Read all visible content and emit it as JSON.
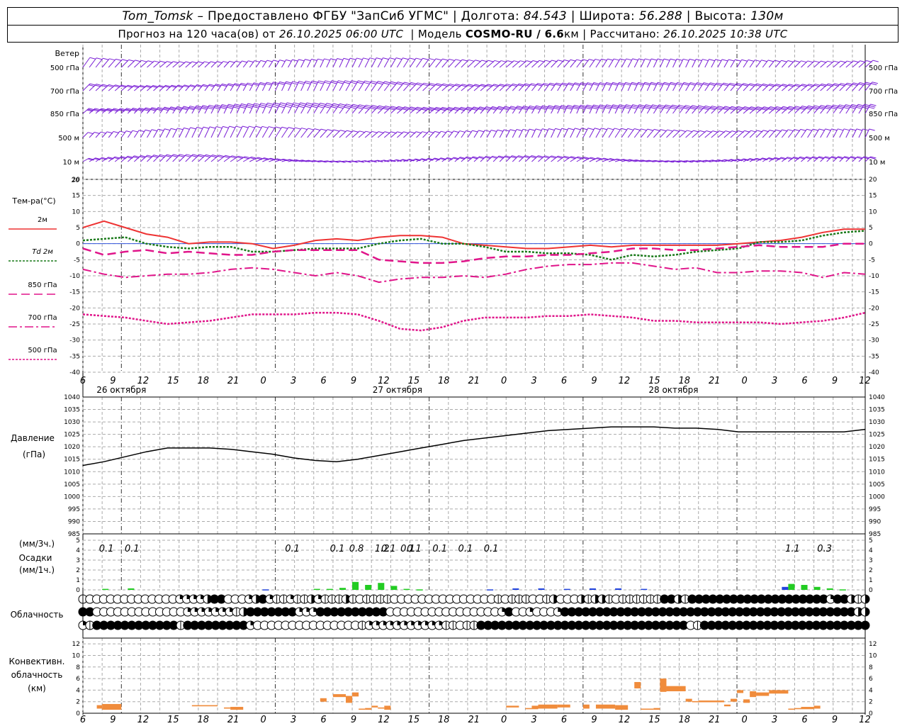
{
  "header": {
    "station": "Tom_Tomsk",
    "provider": "– Предоставлено ФГБУ \"ЗапСиб УГМС\"",
    "lon_label": "Долгота:",
    "lon_value": "84.543",
    "lat_label": "Широта:",
    "lat_value": "56.288",
    "alt_label": "Высота:",
    "alt_value": "130м",
    "forecast_label": "Прогноз на 120 часа(ов) от",
    "forecast_start": "26.10.2025 06:00 UTC",
    "model_label": "Модель",
    "model_name": "COSMO-RU / 6.6",
    "model_unit": "км",
    "calc_label": "Рассчитано:",
    "calc_time": "26.10.2025 10:38 UTC"
  },
  "colors": {
    "wind": "#7a1fd6",
    "t2m": "#ee3333",
    "td2m": "#1a7a1a",
    "t850": "#e0158a",
    "t700": "#e0158a",
    "t500": "#e0158a",
    "pressure": "#000000",
    "precip_rain": "#22cc22",
    "precip_snow": "#2244dd",
    "convective": "#f08c3c",
    "grid": "#aaaaaa",
    "zero_line": "#3355dd"
  },
  "chart_data": {
    "time_axis": {
      "hour_labels": [
        "6",
        "9",
        "12",
        "15",
        "18",
        "21",
        "0",
        "3",
        "6",
        "9",
        "12",
        "15",
        "18",
        "21",
        "0",
        "3",
        "6",
        "9",
        "12",
        "15",
        "18",
        "21",
        "0",
        "3",
        "6",
        "9",
        "12"
      ],
      "date_labels": [
        "26 октября",
        "27 октября",
        "28 октября"
      ]
    },
    "wind_panel": {
      "title": "Ветер",
      "levels": [
        "500 гПа",
        "700 гПа",
        "850 гПа",
        "500 м",
        "10 м"
      ]
    },
    "temperature": {
      "type": "line",
      "ylabel": "Тем-ра(°С)",
      "ylim": [
        -40,
        20
      ],
      "ticks": [
        "20",
        "15",
        "10",
        "5",
        "0",
        "-5",
        "-10",
        "-15",
        "-20",
        "-25",
        "-30",
        "-35",
        "-40"
      ],
      "legend": [
        "2м",
        "Td 2м",
        "850 гПа",
        "700 гПа",
        "500 гПа"
      ],
      "t2m": [
        5,
        7,
        5,
        3,
        2,
        0,
        0.5,
        0.5,
        0,
        -1.5,
        -0.5,
        1,
        1.5,
        1,
        2,
        2.5,
        2.5,
        2,
        0,
        -0.5,
        -1,
        -1.5,
        -1.5,
        -1,
        -0.5,
        -1,
        -0.5,
        -0.5,
        -0.5,
        -0.5,
        -0.5,
        0,
        0.5,
        1,
        2,
        3.5,
        4.5,
        4.5
      ],
      "td2m": [
        1,
        1.5,
        2,
        0,
        -1,
        -1.5,
        -1,
        -1,
        -2.5,
        -2.5,
        -2,
        -1.5,
        -1.5,
        -1.5,
        0,
        1,
        1.5,
        0,
        0,
        -1,
        -2.5,
        -2.5,
        -3,
        -3,
        -3.5,
        -5,
        -3.5,
        -4,
        -3.5,
        -2.5,
        -2,
        -1.5,
        0.5,
        0.5,
        1,
        2.5,
        3.5,
        4
      ],
      "t850": [
        -1.5,
        -3.5,
        -2.5,
        -2,
        -3,
        -2.5,
        -3,
        -3.5,
        -3.5,
        -2.5,
        -2,
        -2,
        -2,
        -2,
        -5,
        -5.5,
        -6,
        -6,
        -5.5,
        -4.5,
        -4,
        -4,
        -3.5,
        -3.5,
        -3,
        -2.5,
        -1.5,
        -1.5,
        -2,
        -2,
        -1.5,
        -1,
        -0.5,
        -1,
        -1,
        -1,
        0,
        0
      ],
      "t700": [
        -8,
        -9.5,
        -10.5,
        -10,
        -9.5,
        -9.5,
        -9,
        -8,
        -7.5,
        -8,
        -9,
        -10,
        -9,
        -10,
        -12,
        -11,
        -10.5,
        -10.5,
        -10,
        -10.5,
        -9.5,
        -8,
        -7,
        -6.5,
        -6.5,
        -6,
        -6,
        -7,
        -8,
        -7.5,
        -9,
        -9,
        -8.5,
        -8.5,
        -9,
        -10.5,
        -9,
        -9.5
      ],
      "t500": [
        -22,
        -22.5,
        -23,
        -24,
        -25,
        -24.5,
        -24,
        -23,
        -22,
        -22,
        -22,
        -21.5,
        -21.5,
        -22,
        -24,
        -26.5,
        -27,
        -26,
        -24,
        -23,
        -23,
        -23,
        -22.5,
        -22.5,
        -22,
        -22.5,
        -23,
        -24,
        -24,
        -24.5,
        -24.5,
        -24.5,
        -24.5,
        -25,
        -24.5,
        -24,
        -23,
        -21.5
      ]
    },
    "pressure": {
      "type": "line",
      "ylabel": "Давление",
      "unit_label": "(гПа)",
      "ylim": [
        985,
        1040
      ],
      "ticks": [
        "1040",
        "1035",
        "1030",
        "1025",
        "1020",
        "1015",
        "1010",
        "1005",
        "1000",
        "995",
        "990",
        "985"
      ],
      "values": [
        1012.5,
        1014,
        1016,
        1018,
        1019.5,
        1019.5,
        1019.5,
        1019,
        1018,
        1017,
        1015.5,
        1014.5,
        1014,
        1015,
        1016.5,
        1018,
        1019.5,
        1021,
        1022.5,
        1023.5,
        1024.5,
        1025.5,
        1026.5,
        1027,
        1027.5,
        1028,
        1028,
        1028,
        1027.5,
        1027.5,
        1027,
        1026,
        1026,
        1026,
        1026,
        1026,
        1026,
        1027
      ]
    },
    "precipitation": {
      "type": "bar",
      "label_3h": "(мм/3ч.)",
      "ylabel": "Осадки",
      "label_1h": "(мм/1ч.)",
      "ylim": [
        0,
        5
      ],
      "ticks": [
        "5",
        "4",
        "3",
        "2",
        "1",
        "0"
      ],
      "amount_labels": [
        {
          "t": 9,
          "text": "0.1"
        },
        {
          "t": 21,
          "text": "0.1"
        },
        {
          "t": 96,
          "text": "0.1"
        },
        {
          "t": 117,
          "text": "0.1"
        },
        {
          "t": 141,
          "text": "0.1"
        },
        {
          "t": 153,
          "text": "0.1"
        },
        {
          "t": 165,
          "text": "0.1"
        },
        {
          "t": 177,
          "text": "0.1"
        },
        {
          "t": 189,
          "text": "0.1"
        },
        {
          "t": 330,
          "text": "1.1"
        },
        {
          "t": 345,
          "text": "0.3"
        }
      ],
      "amount_labels_b": [
        {
          "t": 126,
          "text": "0.8"
        },
        {
          "t": 138,
          "text": "1.2"
        },
        {
          "t": 150,
          "text": "0.1"
        }
      ],
      "bars": [
        {
          "t": 9,
          "v": 0.1,
          "kind": "rain"
        },
        {
          "t": 21,
          "v": 0.15,
          "kind": "rain"
        },
        {
          "t": 84,
          "v": 0.05,
          "kind": "snow"
        },
        {
          "t": 108,
          "v": 0.1,
          "kind": "rain"
        },
        {
          "t": 114,
          "v": 0.1,
          "kind": "rain"
        },
        {
          "t": 120,
          "v": 0.2,
          "kind": "rain"
        },
        {
          "t": 126,
          "v": 0.8,
          "kind": "rain"
        },
        {
          "t": 132,
          "v": 0.5,
          "kind": "rain"
        },
        {
          "t": 138,
          "v": 0.7,
          "kind": "rain"
        },
        {
          "t": 144,
          "v": 0.4,
          "kind": "rain"
        },
        {
          "t": 150,
          "v": 0.1,
          "kind": "rain"
        },
        {
          "t": 156,
          "v": 0.05,
          "kind": "rain"
        },
        {
          "t": 189,
          "v": 0.05,
          "kind": "snow"
        },
        {
          "t": 201,
          "v": 0.15,
          "kind": "snow"
        },
        {
          "t": 213,
          "v": 0.15,
          "kind": "snow"
        },
        {
          "t": 225,
          "v": 0.1,
          "kind": "snow"
        },
        {
          "t": 237,
          "v": 0.15,
          "kind": "snow"
        },
        {
          "t": 249,
          "v": 0.15,
          "kind": "snow"
        },
        {
          "t": 261,
          "v": 0.1,
          "kind": "snow"
        },
        {
          "t": 327,
          "v": 0.3,
          "kind": "snow"
        },
        {
          "t": 330,
          "v": 0.6,
          "kind": "rain"
        },
        {
          "t": 336,
          "v": 0.5,
          "kind": "rain"
        },
        {
          "t": 342,
          "v": 0.3,
          "kind": "rain"
        },
        {
          "t": 348,
          "v": 0.15,
          "kind": "rain"
        },
        {
          "t": 354,
          "v": 0.05,
          "kind": "rain"
        }
      ]
    },
    "cloudiness": {
      "label": "Облачность",
      "rows": [
        [
          1,
          0,
          0,
          0,
          0,
          0,
          0,
          0,
          0,
          0,
          0,
          0,
          0,
          0,
          2,
          2,
          2,
          2,
          3,
          4,
          4,
          0,
          0,
          0,
          2,
          3,
          4,
          2,
          1,
          1,
          2,
          1,
          1,
          3,
          2,
          1,
          1,
          1,
          3,
          1,
          0,
          1,
          1,
          1,
          1,
          0,
          0,
          0,
          0,
          0,
          0,
          0,
          0,
          0,
          0,
          0,
          0,
          0,
          0,
          0,
          1,
          0,
          1,
          1,
          1,
          0,
          0,
          1,
          3,
          0,
          0,
          0,
          3,
          1,
          3,
          3,
          1,
          0,
          1,
          1,
          1,
          1,
          1,
          1,
          4,
          4,
          3,
          1,
          4,
          4,
          4,
          4,
          4,
          4,
          4,
          4,
          4,
          4,
          4,
          4,
          4,
          4,
          4,
          4,
          4,
          4,
          4,
          4,
          2,
          4,
          4,
          3,
          1,
          3
        ],
        [
          4,
          4,
          0,
          0,
          0,
          0,
          0,
          0,
          0,
          0,
          0,
          0,
          0,
          0,
          0,
          2,
          2,
          2,
          2,
          2,
          2,
          2,
          1,
          3,
          4,
          4,
          4,
          4,
          4,
          4,
          4,
          2,
          2,
          2,
          4,
          4,
          4,
          4,
          4,
          4,
          4,
          4,
          4,
          4,
          0,
          0,
          0,
          0,
          0,
          0,
          0,
          0,
          0,
          0,
          0,
          0,
          0,
          0,
          0,
          0,
          2,
          4,
          0,
          0,
          2,
          0,
          0,
          0,
          2,
          4,
          4,
          4,
          4,
          4,
          4,
          4,
          4,
          4,
          4,
          4,
          4,
          4,
          4,
          4,
          4,
          4,
          4,
          4,
          4,
          4,
          4,
          4,
          4,
          4,
          4,
          4,
          4,
          4,
          4,
          4,
          4,
          4,
          4,
          4,
          4,
          4,
          4,
          4,
          4,
          4,
          4,
          3,
          3
        ],
        [
          2,
          1,
          4,
          4,
          4,
          4,
          4,
          4,
          4,
          4,
          4,
          4,
          4,
          4,
          1,
          4,
          4,
          4,
          4,
          4,
          4,
          4,
          4,
          4,
          2,
          0,
          0,
          0,
          0,
          0,
          0,
          0,
          0,
          0,
          0,
          0,
          0,
          0,
          0,
          0,
          1,
          2,
          2,
          2,
          2,
          2,
          2,
          2,
          2,
          2,
          2,
          2,
          1,
          1,
          0,
          1,
          1,
          4,
          4,
          4,
          4,
          4,
          4,
          4,
          4,
          4,
          4,
          4,
          4,
          4,
          4,
          4,
          4,
          4,
          4,
          4,
          4,
          4,
          4,
          4,
          4,
          4,
          4,
          4,
          4,
          4,
          4,
          0,
          1,
          4,
          4,
          4,
          4,
          4,
          4,
          4,
          4,
          4,
          4,
          4,
          4,
          4,
          4,
          4,
          4,
          4,
          4,
          4,
          4,
          4,
          4,
          4,
          4
        ]
      ]
    },
    "convective": {
      "type": "bar",
      "label_lines": [
        "Конвективн.",
        "облачность",
        "(км)"
      ],
      "ylim": [
        0,
        13
      ],
      "ticks": [
        "12",
        "10",
        "8",
        "6",
        "4",
        "2",
        "0"
      ],
      "layers": [
        {
          "t0": 6.5,
          "t1": 9,
          "bot": 0.8,
          "top": 1.4
        },
        {
          "t0": 9,
          "t1": 18,
          "bot": 0.6,
          "top": 1.6
        },
        {
          "t0": 51,
          "t1": 63,
          "bot": 1.2,
          "top": 1.4
        },
        {
          "t0": 66,
          "t1": 69,
          "bot": 0.8,
          "top": 1.0
        },
        {
          "t0": 69,
          "t1": 75,
          "bot": 0.6,
          "top": 1.1
        },
        {
          "t0": 111,
          "t1": 114,
          "bot": 2.0,
          "top": 2.6
        },
        {
          "t0": 117,
          "t1": 123,
          "bot": 2.8,
          "top": 3.3
        },
        {
          "t0": 123,
          "t1": 126,
          "bot": 1.8,
          "top": 3.0
        },
        {
          "t0": 126,
          "t1": 129,
          "bot": 2.9,
          "top": 3.6
        },
        {
          "t0": 129,
          "t1": 132,
          "bot": 0.6,
          "top": 0.8
        },
        {
          "t0": 132,
          "t1": 135,
          "bot": 0.6,
          "top": 0.9
        },
        {
          "t0": 135,
          "t1": 138,
          "bot": 1.0,
          "top": 1.3
        },
        {
          "t0": 138,
          "t1": 141,
          "bot": 0.8,
          "top": 1.0
        },
        {
          "t0": 141,
          "t1": 144,
          "bot": 0.6,
          "top": 1.3
        },
        {
          "t0": 198,
          "t1": 204,
          "bot": 1.0,
          "top": 1.3
        },
        {
          "t0": 207,
          "t1": 210,
          "bot": 0.7,
          "top": 0.9
        },
        {
          "t0": 210,
          "t1": 213,
          "bot": 0.7,
          "top": 1.3
        },
        {
          "t0": 213,
          "t1": 222,
          "bot": 0.8,
          "top": 1.5
        },
        {
          "t0": 222,
          "t1": 228,
          "bot": 1.0,
          "top": 1.5
        },
        {
          "t0": 234,
          "t1": 237,
          "bot": 0.8,
          "top": 1.5
        },
        {
          "t0": 240,
          "t1": 249,
          "bot": 0.8,
          "top": 1.5
        },
        {
          "t0": 249,
          "t1": 255,
          "bot": 0.6,
          "top": 1.4
        },
        {
          "t0": 258,
          "t1": 261,
          "bot": 4.3,
          "top": 5.4
        },
        {
          "t0": 261,
          "t1": 267,
          "bot": 0.6,
          "top": 0.8
        },
        {
          "t0": 267,
          "t1": 270,
          "bot": 0.6,
          "top": 0.9
        },
        {
          "t0": 270,
          "t1": 273,
          "bot": 3.7,
          "top": 6.0
        },
        {
          "t0": 273,
          "t1": 282,
          "bot": 3.8,
          "top": 4.7
        },
        {
          "t0": 282,
          "t1": 285,
          "bot": 2.0,
          "top": 2.5
        },
        {
          "t0": 285,
          "t1": 288,
          "bot": 1.9,
          "top": 2.1
        },
        {
          "t0": 288,
          "t1": 300,
          "bot": 1.9,
          "top": 2.2
        },
        {
          "t0": 300,
          "t1": 303,
          "bot": 1.2,
          "top": 1.5
        },
        {
          "t0": 303,
          "t1": 306,
          "bot": 2.0,
          "top": 2.5
        },
        {
          "t0": 306,
          "t1": 309,
          "bot": 3.5,
          "top": 4.0
        },
        {
          "t0": 309,
          "t1": 312,
          "bot": 1.8,
          "top": 2.4
        },
        {
          "t0": 312,
          "t1": 315,
          "bot": 2.8,
          "top": 3.8
        },
        {
          "t0": 315,
          "t1": 321,
          "bot": 3.0,
          "top": 3.6
        },
        {
          "t0": 321,
          "t1": 330,
          "bot": 3.4,
          "top": 4.0
        },
        {
          "t0": 330,
          "t1": 333,
          "bot": 0.6,
          "top": 0.8
        },
        {
          "t0": 333,
          "t1": 336,
          "bot": 0.7,
          "top": 0.9
        },
        {
          "t0": 336,
          "t1": 342,
          "bot": 0.7,
          "top": 1.1
        },
        {
          "t0": 342,
          "t1": 345,
          "bot": 0.8,
          "top": 1.3
        }
      ]
    }
  }
}
